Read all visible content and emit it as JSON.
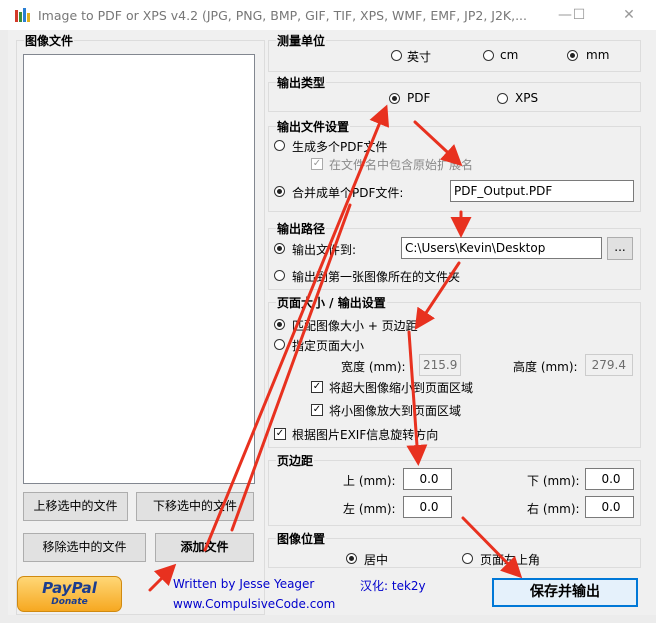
{
  "window": {
    "title": "Image to PDF or XPS  v4.2   (JPG, PNG, BMP, GIF, TIF, XPS, WMF, EMF, JP2, J2K,...",
    "minimize": "—",
    "maximize": "☐",
    "close": "✕"
  },
  "left": {
    "group_title": "图像文件",
    "move_up": "上移选中的文件",
    "move_down": "下移选中的文件",
    "remove": "移除选中的文件",
    "add": "添加文件"
  },
  "units": {
    "title": "测量单位",
    "options": [
      "英寸",
      "cm",
      "mm"
    ],
    "selected": "mm"
  },
  "output_type": {
    "title": "输出类型",
    "options": [
      "PDF",
      "XPS"
    ],
    "selected": "PDF"
  },
  "output_file": {
    "title": "输出文件设置",
    "multi": "生成多个PDF文件",
    "include_ext": "在文件名中包含原始扩展名",
    "single": "合并成单个PDF文件:",
    "filename": "PDF_Output.PDF"
  },
  "output_path": {
    "title": "输出路径",
    "to": "输出文件到:",
    "path": "C:\\Users\\Kevin\\Desktop",
    "browse": "...",
    "first_image": "输出到第一张图像所在的文件夹"
  },
  "page_size": {
    "title": "页面大小 / 输出设置",
    "match": "匹配图像大小 + 页边距",
    "specify": "指定页面大小",
    "width_label": "宽度 (mm):",
    "width": "215.9",
    "height_label": "高度 (mm):",
    "height": "279.4",
    "shrink": "将超大图像缩小到页面区域",
    "enlarge": "将小图像放大到页面区域",
    "exif": "根据图片EXIF信息旋转方向"
  },
  "margins": {
    "title": "页边距",
    "top_label": "上 (mm):",
    "top": "0.0",
    "bottom_label": "下 (mm):",
    "bottom": "0.0",
    "left_label": "左 (mm):",
    "left": "0.0",
    "right_label": "右 (mm):",
    "right": "0.0"
  },
  "position": {
    "title": "图像位置",
    "center": "居中",
    "top_left": "页面左上角"
  },
  "footer": {
    "paypal": "PayPal",
    "donate": "Donate",
    "author": "Written by Jesse Yeager",
    "site": "www.CompulsiveCode.com",
    "localization": "汉化: tek2y",
    "save": "保存并输出"
  },
  "colors": {
    "arrow": "#e8311f",
    "link": "#0000cc"
  }
}
